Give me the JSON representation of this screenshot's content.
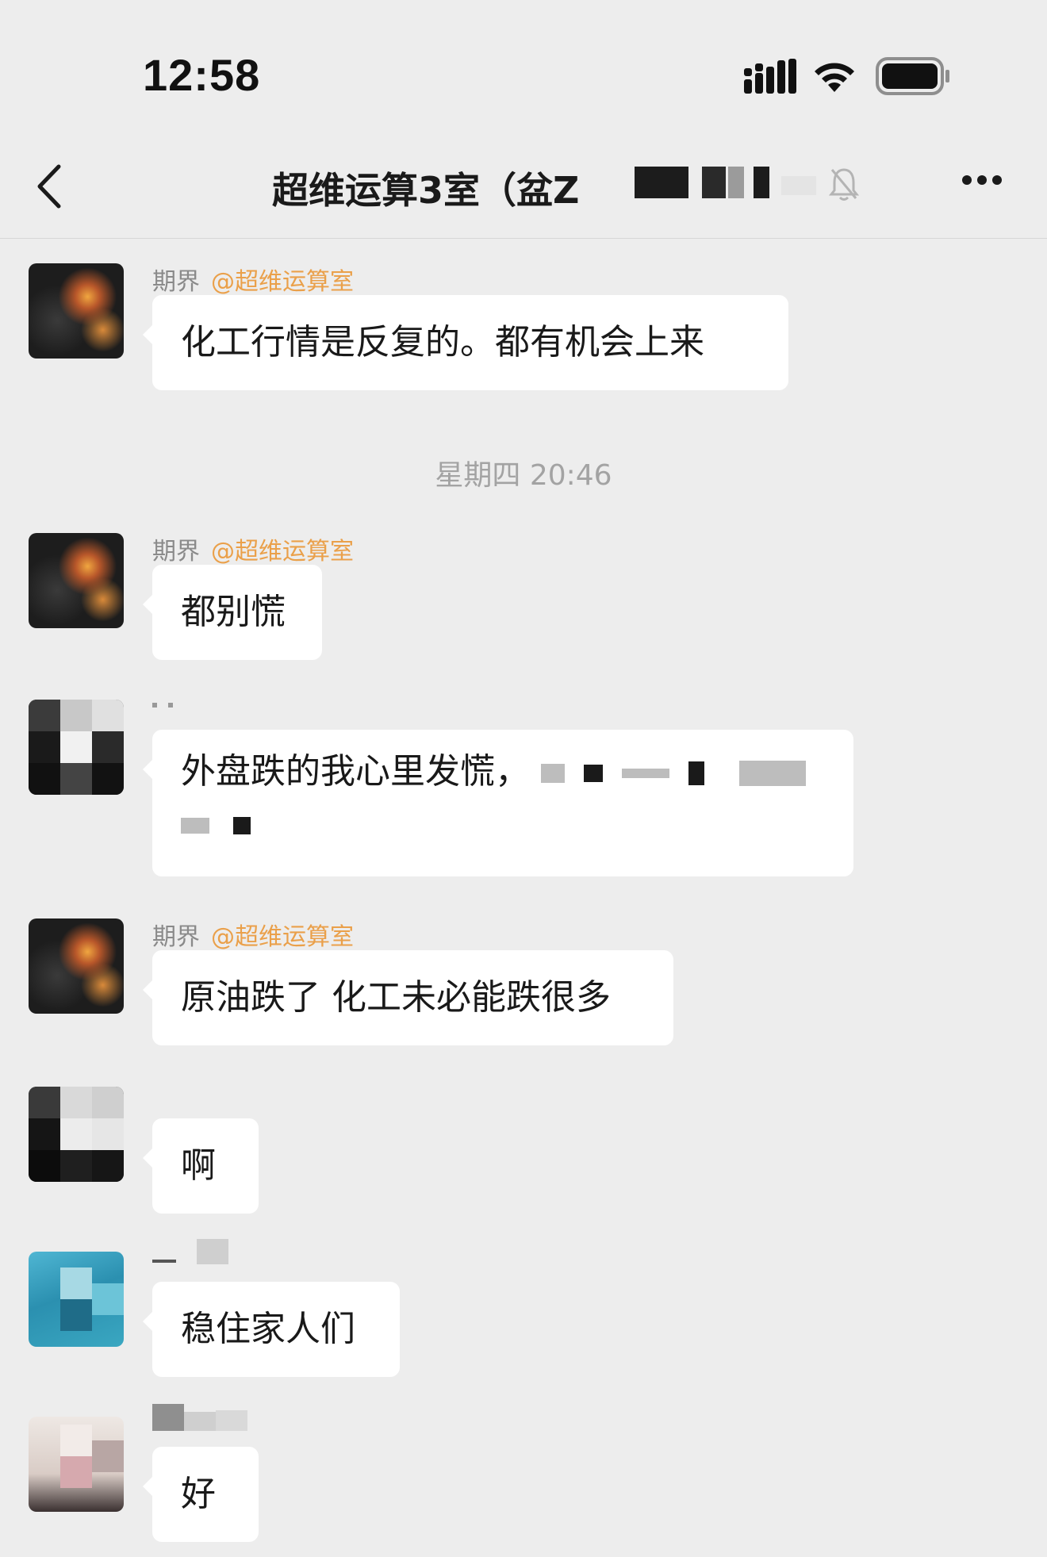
{
  "status_bar": {
    "time": "12:58",
    "icons": [
      "signal-icon",
      "wifi-icon",
      "battery-icon"
    ]
  },
  "nav": {
    "back_icon": "chevron-left-icon",
    "title": "超维运算3室（盆Z",
    "mute_icon": "bell-muted-icon",
    "more_icon": "more-dots-icon"
  },
  "chat": {
    "timestamp": "星期四 20:46",
    "messages": [
      {
        "sender": "期界",
        "mention": "@超维运算室",
        "text": "化工行情是反复的。都有机会上来"
      },
      {
        "sender": "期界",
        "mention": "@超维运算室",
        "text": "都别慌"
      },
      {
        "sender": "",
        "mention": "",
        "text": "外盘跌的我心里发慌，"
      },
      {
        "sender": "期界",
        "mention": "@超维运算室",
        "text": "原油跌了 化工未必能跌很多"
      },
      {
        "sender": "",
        "mention": "",
        "text": "啊"
      },
      {
        "sender": "",
        "mention": "",
        "text": "稳住家人们"
      },
      {
        "sender": "",
        "mention": "",
        "text": "好"
      }
    ]
  },
  "colors": {
    "background": "#ededed",
    "bubble": "#ffffff",
    "mention": "#eaa04a",
    "sender": "#8a8a8a"
  }
}
